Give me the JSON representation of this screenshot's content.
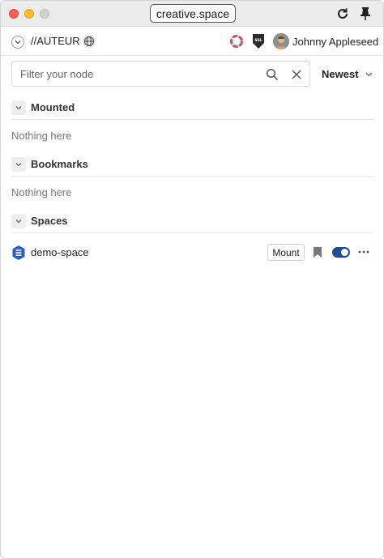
{
  "window": {
    "url": "creative.space"
  },
  "header": {
    "node_name": "//AUTEUR",
    "user_name": "Johnny Appleseed",
    "ssl_label": "SSL"
  },
  "filter": {
    "placeholder": "Filter your node",
    "value": "",
    "sort_label": "Newest"
  },
  "sections": {
    "mounted": {
      "title": "Mounted",
      "empty_text": "Nothing here"
    },
    "bookmarks": {
      "title": "Bookmarks",
      "empty_text": "Nothing here"
    },
    "spaces": {
      "title": "Spaces",
      "items": [
        {
          "name": "demo-space",
          "mount_label": "Mount",
          "enabled": true
        }
      ]
    }
  },
  "colors": {
    "accent": "#1e4d91",
    "close": "#fe5f57",
    "minimize": "#febc2e"
  }
}
